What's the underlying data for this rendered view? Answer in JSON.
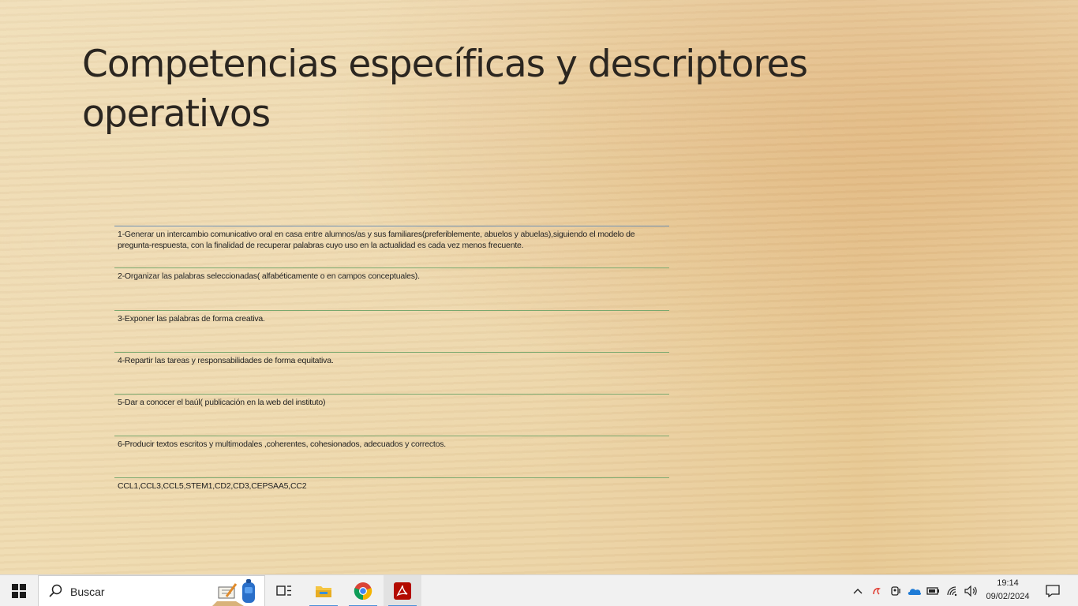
{
  "slide": {
    "title": "Competencias específicas y descriptores operativos",
    "rows": [
      "1-Generar un intercambio comunicativo oral en casa entre alumnos/as y sus familiares(preferiblemente, abuelos y abuelas),siguiendo el modelo de pregunta-respuesta, con la finalidad de recuperar palabras cuyo uso en la actualidad es cada vez menos frecuente.",
      "2-Organizar las palabras seleccionadas( alfabéticamente o en campos conceptuales).",
      "3-Exponer las palabras de forma creativa.",
      "4-Repartir las tareas y responsabilidades de forma equitativa.",
      "5-Dar a conocer el baúl( publicación en la web del instituto)",
      "6-Producir textos escritos y multimodales ,coherentes, cohesionados, adecuados y correctos.",
      "CCL1,CCL3,CCL5,STEM1,CD2,CD3,CEPSAA5,CC2"
    ]
  },
  "taskbar": {
    "search_placeholder": "Buscar",
    "time": "19:14",
    "date": "09/02/2024",
    "icons": [
      "windows-start-icon",
      "search-icon",
      "task-view-icon",
      "file-explorer-icon",
      "chrome-icon",
      "acrobat-icon"
    ],
    "tray_icons": [
      "chevron-up-icon",
      "antivirus-icon",
      "meet-now-icon",
      "onedrive-icon",
      "battery-icon",
      "wifi-icon",
      "volume-icon",
      "notifications-icon"
    ]
  }
}
